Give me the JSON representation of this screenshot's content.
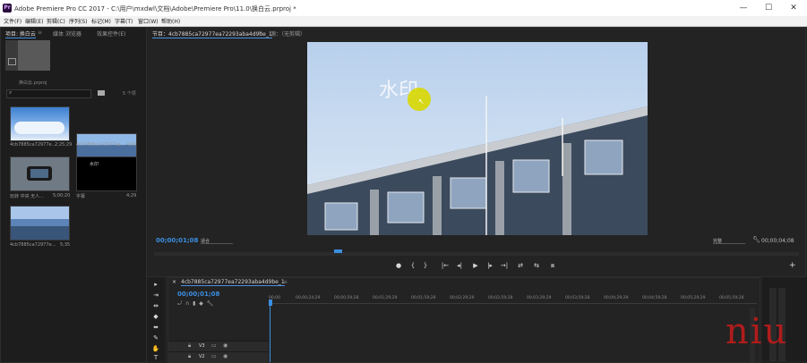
{
  "window": {
    "title": "Adobe Premiere Pro CC 2017 - C:\\用户\\mxdwl\\文档\\Adobe\\Premiere Pro\\11.0\\换白云.prproj *",
    "app_icon": "Pr",
    "minimize_icon": "—",
    "maximize_icon": "☐",
    "close_icon": "✕"
  },
  "menu": [
    "文件(F)",
    "编辑(E)",
    "剪辑(C)",
    "序列(S)",
    "标记(M)",
    "字幕(T)",
    "窗口(W)",
    "帮助(H)"
  ],
  "project_panel": {
    "tabs": [
      "项目: 换白云",
      "媒体 浏览器",
      "效果控件(E)"
    ],
    "tab_menu": "≡",
    "project_name": "换白云.prproj",
    "search_placeholder": "",
    "item_count": "5 个项",
    "items": [
      {
        "name": "4cb7885ca72977e...",
        "duration": "2;25;29"
      },
      {
        "name": "4cb7885ca72977ea...",
        "duration": "4;00"
      },
      {
        "name": "玩转 中央 无人...",
        "duration": "5;00;20"
      },
      {
        "name": "字幕",
        "duration": "4;29",
        "inner": "水印"
      },
      {
        "name": "4cb7885ca72977e...",
        "duration": "5;35"
      }
    ]
  },
  "source_tab": "节目：4cb7885ca72977ea72293aba4d9be_1",
  "source_tab_menu": "≡",
  "source_tab_2": "源：（无剪辑）",
  "program": {
    "watermark": "水印",
    "timecode": "00;00;01;08",
    "fit": "适合",
    "quality": "完整",
    "duration": "00;00;04;08",
    "add_button": "+"
  },
  "transport": [
    "●",
    "{",
    "}",
    "|←",
    "◂|",
    "▶",
    "|▸",
    "→|",
    "⇄",
    "⇆",
    "⧈"
  ],
  "timeline": {
    "tab": "4cb7885ca72977ea72293aba4d9be_1",
    "close_icon": "×",
    "tab_menu": "≡",
    "timecode": "00;00;01;08",
    "ruler": [
      "00;00",
      "00;00;24;29",
      "00;00;59;28",
      "00;01;29;29",
      "00;01;59;28",
      "00;02;29;29",
      "00;02;59;28",
      "00;03;29;29",
      "00;03;59;28",
      "00;04;29;29",
      "00;04;59;28",
      "00;05;29;29",
      "00;05;59;28"
    ],
    "tracks": [
      "V3",
      "V2"
    ],
    "tools": [
      "▸",
      "⇥",
      "⇹",
      "◆",
      "⬌",
      "✎",
      "✋",
      "T"
    ]
  },
  "watermark_overlay": "niu",
  "colors": {
    "accent": "#3b8ee0",
    "cursor": "#d8d800",
    "overlay": "#b01c1c"
  }
}
